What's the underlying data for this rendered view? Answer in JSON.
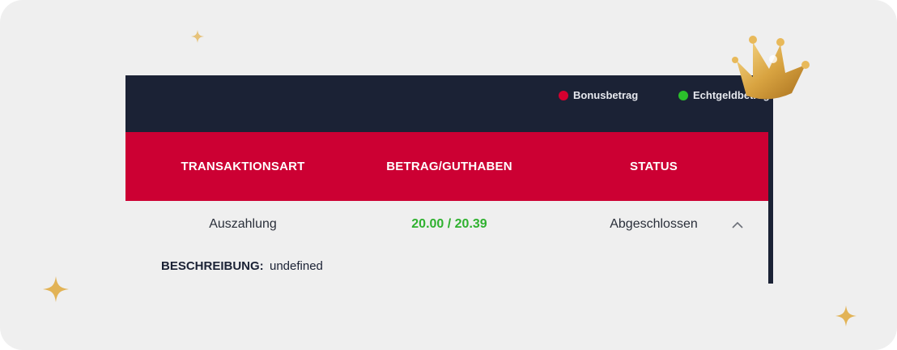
{
  "legend": {
    "bonus_label": "Bonusbetrag",
    "bonus_color": "#d4002f",
    "real_label": "Echtgeldbetrag",
    "real_color": "#2bbf2b"
  },
  "table": {
    "columns": [
      "TRANSAKTIONSART",
      "BETRAG/GUTHABEN",
      "STATUS"
    ],
    "rows": [
      {
        "type": "Auszahlung",
        "amount": "20.00 / 20.39",
        "status": "Abgeschlossen",
        "expanded": true,
        "description_label": "BESCHREIBUNG:",
        "description_value": "undefined"
      }
    ]
  },
  "decorations": {
    "crown": "crown-icon",
    "sparkle": "sparkle-icon"
  }
}
